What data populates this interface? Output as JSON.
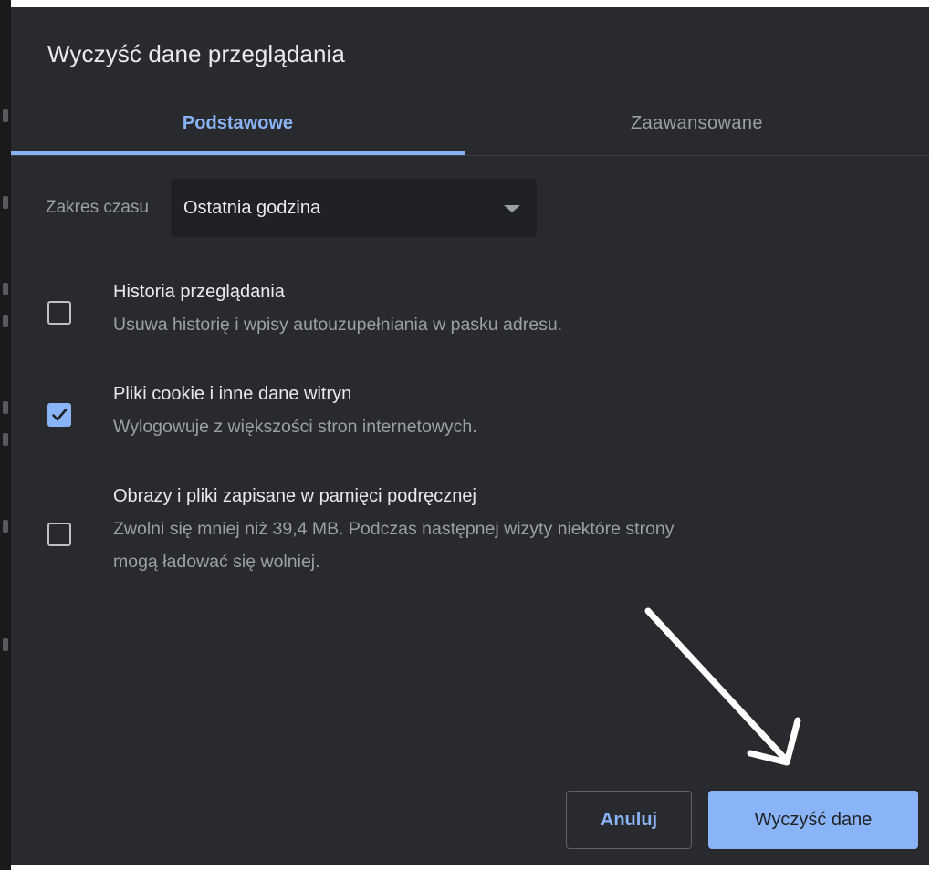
{
  "dialog": {
    "title": "Wyczyść dane przeglądania"
  },
  "tabs": [
    {
      "label": "Podstawowe",
      "active": true
    },
    {
      "label": "Zaawansowane",
      "active": false
    }
  ],
  "time_range": {
    "label": "Zakres czasu",
    "value": "Ostatnia godzina"
  },
  "options": [
    {
      "title": "Historia przeglądania",
      "description": "Usuwa historię i wpisy autouzupełniania w pasku adresu.",
      "checked": false
    },
    {
      "title": "Pliki cookie i inne dane witryn",
      "description": "Wylogowuje z większości stron internetowych.",
      "checked": true
    },
    {
      "title": "Obrazy i pliki zapisane w pamięci podręcznej",
      "description_line1": "Zwolni się mniej niż 39,4 MB. Podczas następnej wizyty niektóre strony",
      "description_line2": "mogą ładować się wolniej.",
      "checked": false
    }
  ],
  "buttons": {
    "cancel": "Anuluj",
    "clear": "Wyczyść dane"
  },
  "colors": {
    "dialog_bg": "#292a2d",
    "accent": "#8ab4f8",
    "text_primary": "#e8eaed",
    "text_secondary": "#9aa0a6"
  },
  "annotation": {
    "icon": "arrow-annotation-icon",
    "color": "#ffffff"
  }
}
